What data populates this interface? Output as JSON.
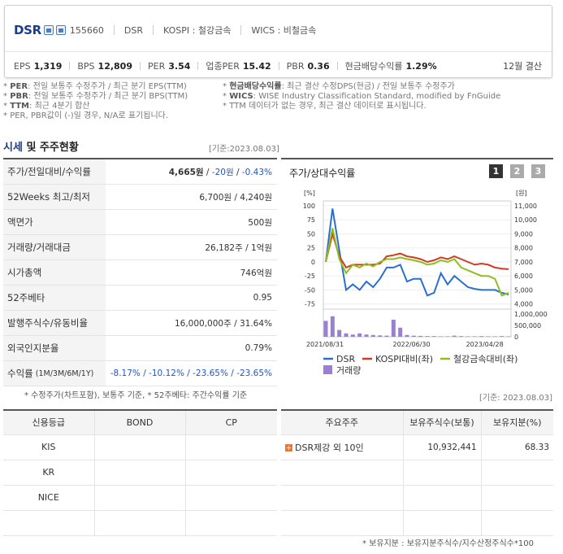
{
  "header": {
    "name": "DSR",
    "code": "155660",
    "company": "DSR",
    "market": "KOSPI : 철강금속",
    "wics": "WICS : 비철금속",
    "settlement": "12월 결산",
    "metrics": [
      {
        "label": "EPS",
        "value": "1,319"
      },
      {
        "label": "BPS",
        "value": "12,809"
      },
      {
        "label": "PER",
        "value": "3.54"
      },
      {
        "label": "업종PER",
        "value": "15.42"
      },
      {
        "label": "PBR",
        "value": "0.36"
      },
      {
        "label": "현금배당수익률",
        "value": "1.29%"
      }
    ]
  },
  "notes": {
    "left": [
      {
        "key": "PER",
        "text": ": 전일 보통주 수정주가 / 최근 분기 EPS(TTM)"
      },
      {
        "key": "PBR",
        "text": ": 전일 보통주 수정주가 / 최근 분기 BPS(TTM)"
      },
      {
        "key": "TTM",
        "text": ": 최근 4분기 합산"
      },
      {
        "key": "",
        "text": "PER, PBR값이 (-)일 경우, N/A로 표기됩니다."
      }
    ],
    "right": [
      {
        "key": "현금배당수익률",
        "text": ": 최근 결산 수정DPS(현금) / 전일 보통주 수정주가"
      },
      {
        "key": "WICS",
        "text": ": WISE Industry Classification Standard, modified by FnGuide"
      },
      {
        "key": "",
        "text": "TTM 데이터가 없는 경우, 최근 결산 데이터로 표시됩니다."
      }
    ]
  },
  "section": {
    "title_a": "시세",
    "title_b": " 및 주주현황",
    "base_date": "[기준:2023.08.03]"
  },
  "quote": {
    "rows": [
      {
        "label": "주가/전일대비/수익률",
        "v1": "4,665원",
        "v2": "-20원",
        "v3": "-0.43%"
      },
      {
        "label": "52Weeks 최고/최저",
        "value": "6,700원 / 4,240원"
      },
      {
        "label": "액면가",
        "value": "500원"
      },
      {
        "label": "거래량/거래대금",
        "value": "26,182주 / 1억원"
      },
      {
        "label": "시가총액",
        "value": "746억원"
      },
      {
        "label": "52주베타",
        "value": "0.95"
      },
      {
        "label": "발행주식수/유동비율",
        "value": "16,000,000주 / 31.64%"
      },
      {
        "label": "외국인지분율",
        "value": "0.79%"
      },
      {
        "label": "수익률",
        "sub": "(1M/3M/6M/1Y)",
        "value": "-8.17% / -10.12% / -23.65% / -23.65%"
      }
    ],
    "footnote": "* 수정주가(차트포함), 보통주 기준, * 52주베타: 주간수익률 기준"
  },
  "chart_panel": {
    "title": "주가/상대수익률",
    "pages": [
      "1",
      "2",
      "3"
    ]
  },
  "chart_data": {
    "type": "line",
    "left_unit": "[%]",
    "right_unit": "[원]",
    "volume_unit": "",
    "left_ticks": [
      "100",
      "75",
      "50",
      "25",
      "0",
      "-25",
      "-50",
      "-75"
    ],
    "right_ticks": [
      "11,000",
      "10,000",
      "9,000",
      "8,000",
      "7,000",
      "6,000",
      "5,000",
      "4,000"
    ],
    "volume_ticks": [
      "1,000,000",
      "500,000",
      "0"
    ],
    "x_ticks": [
      "2021/08/31",
      "2022/06/30",
      "2023/04/28"
    ],
    "ylim_left": [
      -100,
      100
    ],
    "series": [
      {
        "name": "DSR",
        "color": "#2a6fd0",
        "values": [
          0,
          95,
          20,
          -50,
          -40,
          -50,
          -35,
          -45,
          -30,
          -10,
          -10,
          -5,
          -35,
          -30,
          -30,
          -60,
          -55,
          -20,
          -40,
          -25,
          -35,
          -45,
          -48,
          -50,
          -50,
          -50,
          -55,
          -58
        ]
      },
      {
        "name": "KOSPI대비(좌)",
        "color": "#d23b1e",
        "values": [
          0,
          50,
          10,
          -10,
          -5,
          -5,
          -5,
          -5,
          -3,
          10,
          12,
          15,
          10,
          8,
          5,
          0,
          3,
          8,
          5,
          10,
          5,
          0,
          -5,
          -3,
          -5,
          -10,
          -12,
          -13
        ]
      },
      {
        "name": "철강금속대비(좌)",
        "color": "#8fbf1e",
        "values": [
          0,
          60,
          5,
          -20,
          -5,
          -10,
          -3,
          -8,
          0,
          5,
          5,
          8,
          5,
          3,
          0,
          -5,
          -3,
          3,
          0,
          5,
          -10,
          -15,
          -20,
          -25,
          -25,
          -30,
          -60,
          -55
        ]
      },
      {
        "name": "거래량",
        "color": "#9b7fd0",
        "type": "bar",
        "values": [
          700000,
          900000,
          300000,
          150000,
          100000,
          150000,
          100000,
          80000,
          60000,
          50000,
          750000,
          400000,
          80000,
          50000,
          40000,
          30000,
          30000,
          20000,
          20000,
          50000,
          30000,
          20000,
          20000,
          30000,
          20000,
          20000,
          30000,
          20000
        ]
      }
    ]
  },
  "credit": {
    "headers": [
      "신용등급",
      "BOND",
      "CP"
    ],
    "rows": [
      "KIS",
      "KR",
      "NICE",
      ""
    ]
  },
  "shareholders": {
    "base_date": "[기준: 2023.08.03]",
    "headers": [
      "주요주주",
      "보유주식수(보통)",
      "보유지분(%)"
    ],
    "rows": [
      {
        "name": "DSR제강 외 10인",
        "shares": "10,932,441",
        "pct": "68.33"
      }
    ],
    "footnote": "* 보유지분 : 보유지분주식수/지수산정주식수*100"
  }
}
